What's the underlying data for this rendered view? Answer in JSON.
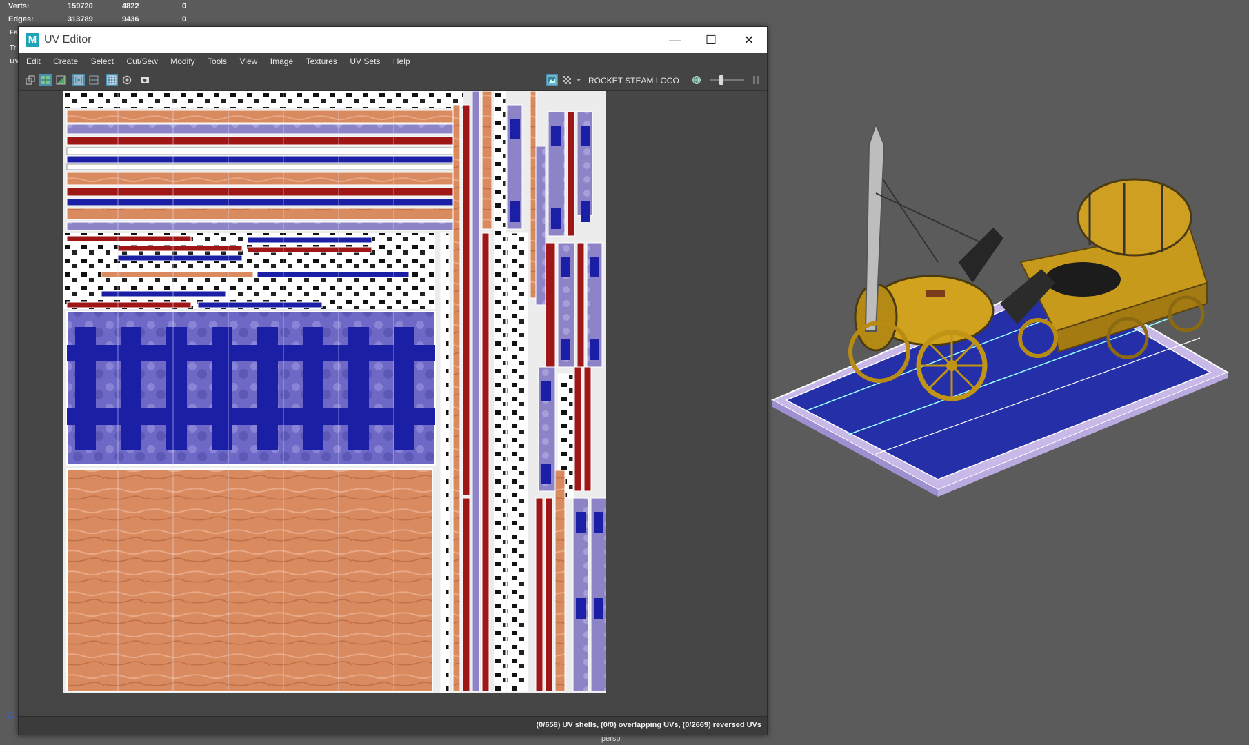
{
  "hud": {
    "rows": [
      {
        "label": "Verts:",
        "v1": "159720",
        "v2": "4822",
        "v3": "0"
      },
      {
        "label": "Edges:",
        "v1": "313789",
        "v2": "9436",
        "v3": "0"
      }
    ],
    "side_letters": [
      "Fa",
      "Tr",
      "UV"
    ]
  },
  "uv_editor": {
    "title": "UV Editor",
    "logo": "M",
    "window_buttons": {
      "minimize": "—",
      "maximize": "☐",
      "close": "✕"
    },
    "menu": [
      "Edit",
      "Create",
      "Select",
      "Cut/Sew",
      "Modify",
      "Tools",
      "View",
      "Image",
      "Textures",
      "UV Sets",
      "Help"
    ],
    "toolbar_icons": [
      "uv-layout-icon",
      "shaded-uv-icon",
      "texture-borders-icon",
      "uv-grid-icon",
      "uv-frame-icon",
      "checkerboard-grid-icon",
      "isolate-icon",
      "snapshot-icon"
    ],
    "image_display_icons": [
      "image-display-icon",
      "checker-tile-icon"
    ],
    "uv_set_name": "ROCKET STEAM LOCO",
    "status": "(0/658) UV shells, (0/0) overlapping UVs, (0/2669) reversed UVs"
  },
  "viewport": {
    "camera_label": "persp"
  },
  "colors": {
    "background": "#5b5b5b",
    "wood": "#d98a5e",
    "blue_stone": "#1a1fa6",
    "lavender": "#8a7fc4",
    "red": "#9e1616",
    "accent": "#4b8fb0"
  }
}
